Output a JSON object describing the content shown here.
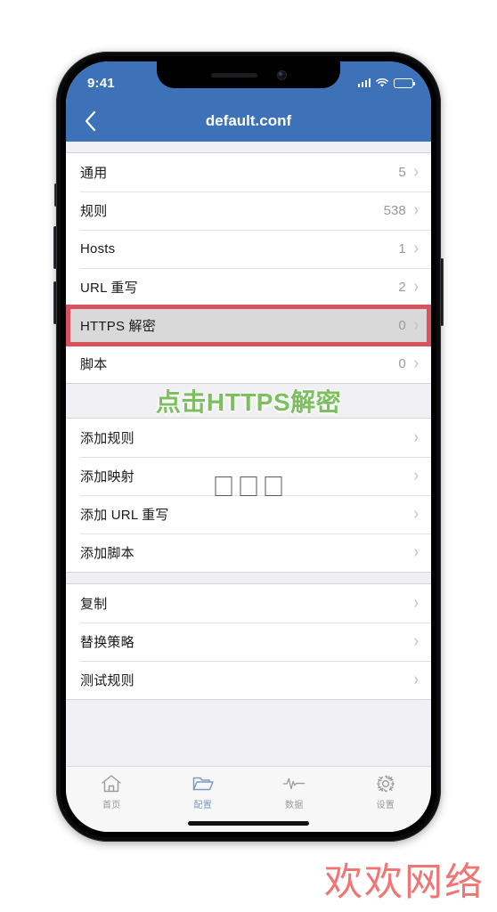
{
  "status_bar": {
    "time": "9:41",
    "signal_icon": "cellular-bars-icon",
    "wifi_icon": "wifi-icon",
    "battery_icon": "battery-icon"
  },
  "nav": {
    "back_icon": "chevron-left-icon",
    "title": "default.conf"
  },
  "groups": [
    {
      "rows": [
        {
          "label": "通用",
          "value": "5",
          "chevron": "›"
        },
        {
          "label": "规则",
          "value": "538",
          "chevron": "›"
        },
        {
          "label": "Hosts",
          "value": "1",
          "chevron": "›"
        },
        {
          "label": "URL 重写",
          "value": "2",
          "chevron": "›"
        },
        {
          "label": "HTTPS 解密",
          "value": "0",
          "chevron": "›"
        },
        {
          "label": "脚本",
          "value": "0",
          "chevron": "›"
        }
      ]
    },
    {
      "rows": [
        {
          "label": "添加规则",
          "value": "",
          "chevron": "›"
        },
        {
          "label": "添加映射",
          "value": "",
          "chevron": "›"
        },
        {
          "label": "添加 URL 重写",
          "value": "",
          "chevron": "›"
        },
        {
          "label": "添加脚本",
          "value": "",
          "chevron": "›"
        }
      ]
    },
    {
      "rows": [
        {
          "label": "复制",
          "value": "",
          "chevron": "›"
        },
        {
          "label": "替换策略",
          "value": "",
          "chevron": "›"
        },
        {
          "label": "测试规则",
          "value": "",
          "chevron": "›"
        }
      ]
    }
  ],
  "annotation": {
    "text": "点击HTTPS解密",
    "color": "#7cbf5e"
  },
  "highlight": {
    "target_label": "HTTPS 解密",
    "border_color": "#d9535e",
    "row_background": "#d9d9d9"
  },
  "tofu_glyphs": [
    "□",
    "□",
    "□"
  ],
  "tab_bar": {
    "items": [
      {
        "label": "首页",
        "icon": "home-icon",
        "active": false
      },
      {
        "label": "配置",
        "icon": "folder-icon",
        "active": true
      },
      {
        "label": "数据",
        "icon": "pulse-icon",
        "active": false
      },
      {
        "label": "设置",
        "icon": "gear-icon",
        "active": false
      }
    ],
    "active_color": "#7a9bc4",
    "inactive_color": "#9b9b9b"
  },
  "watermark": {
    "text": "欢欢网络",
    "color": "#f06a6a"
  },
  "theme": {
    "header_blue": "#3d72b8",
    "page_background": "#efeff4",
    "row_background": "#ffffff"
  }
}
